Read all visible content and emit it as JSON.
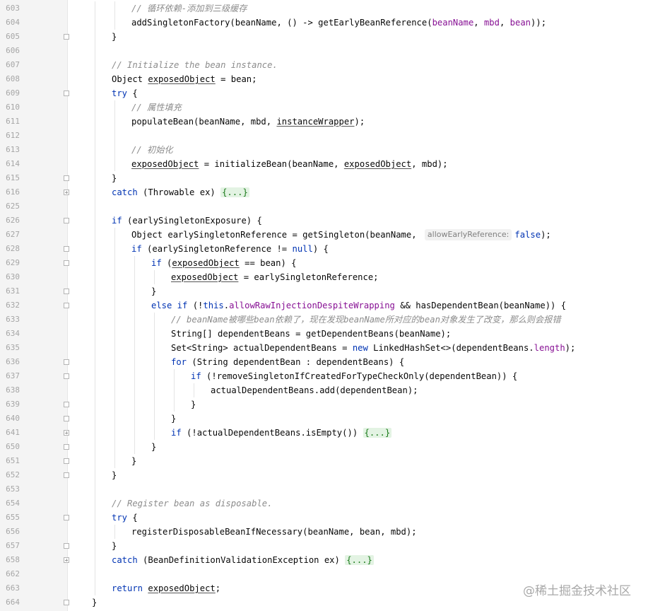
{
  "editor": {
    "lines": [
      {
        "n": "603",
        "indent": 3,
        "fold": "",
        "segs": [
          [
            "cm",
            "// 循环依赖-添加到三级缓存"
          ]
        ]
      },
      {
        "n": "604",
        "indent": 3,
        "fold": "",
        "segs": [
          [
            "",
            "addSingletonFactory(beanName, () -> getEarlyBeanReference("
          ],
          [
            "fd",
            "beanName"
          ],
          [
            "",
            ", "
          ],
          [
            "fd",
            "mbd"
          ],
          [
            "",
            ", "
          ],
          [
            "fd",
            "bean"
          ],
          [
            "",
            "));"
          ]
        ]
      },
      {
        "n": "605",
        "indent": 2,
        "fold": "end",
        "segs": [
          [
            "",
            "}"
          ]
        ]
      },
      {
        "n": "606",
        "indent": 0,
        "fold": "",
        "segs": []
      },
      {
        "n": "607",
        "indent": 2,
        "fold": "",
        "segs": [
          [
            "cm",
            "// Initialize the bean instance."
          ]
        ]
      },
      {
        "n": "608",
        "indent": 2,
        "fold": "",
        "segs": [
          [
            "",
            "Object "
          ],
          [
            "ul",
            "exposedObject"
          ],
          [
            "",
            " = bean;"
          ]
        ]
      },
      {
        "n": "609",
        "indent": 2,
        "fold": "start",
        "segs": [
          [
            "kw",
            "try"
          ],
          [
            "",
            " {"
          ]
        ]
      },
      {
        "n": "610",
        "indent": 3,
        "fold": "",
        "segs": [
          [
            "cm",
            "// 属性填充"
          ]
        ]
      },
      {
        "n": "611",
        "indent": 3,
        "fold": "",
        "segs": [
          [
            "",
            "populateBean(beanName, mbd, "
          ],
          [
            "ul",
            "instanceWrapper"
          ],
          [
            "",
            ");"
          ]
        ]
      },
      {
        "n": "612",
        "indent": 0,
        "fold": "",
        "segs": []
      },
      {
        "n": "613",
        "indent": 3,
        "fold": "",
        "segs": [
          [
            "cm",
            "// 初始化"
          ]
        ]
      },
      {
        "n": "614",
        "indent": 3,
        "fold": "",
        "segs": [
          [
            "ul",
            "exposedObject"
          ],
          [
            "",
            " = initializeBean(beanName, "
          ],
          [
            "ul",
            "exposedObject"
          ],
          [
            "",
            ", mbd);"
          ]
        ]
      },
      {
        "n": "615",
        "indent": 2,
        "fold": "end",
        "segs": [
          [
            "",
            "}"
          ]
        ]
      },
      {
        "n": "616",
        "indent": 2,
        "fold": "plus",
        "segs": [
          [
            "kw",
            "catch"
          ],
          [
            "",
            " (Throwable ex) "
          ],
          [
            "fl",
            "{...}"
          ]
        ]
      },
      {
        "n": "625",
        "indent": 0,
        "fold": "",
        "segs": []
      },
      {
        "n": "626",
        "indent": 2,
        "fold": "start",
        "segs": [
          [
            "kw",
            "if"
          ],
          [
            "",
            " (earlySingletonExposure) {"
          ]
        ]
      },
      {
        "n": "627",
        "indent": 3,
        "fold": "",
        "segs": [
          [
            "",
            "Object earlySingletonReference = getSingleton(beanName, "
          ],
          [
            "hint",
            "allowEarlyReference:"
          ],
          [
            "kw",
            "false"
          ],
          [
            "",
            ");"
          ]
        ]
      },
      {
        "n": "628",
        "indent": 3,
        "fold": "start",
        "segs": [
          [
            "kw",
            "if"
          ],
          [
            "",
            " (earlySingletonReference != "
          ],
          [
            "kw",
            "null"
          ],
          [
            "",
            ") {"
          ]
        ]
      },
      {
        "n": "629",
        "indent": 4,
        "fold": "start",
        "segs": [
          [
            "kw",
            "if"
          ],
          [
            "",
            " ("
          ],
          [
            "ul",
            "exposedObject"
          ],
          [
            "",
            " == bean) {"
          ]
        ]
      },
      {
        "n": "630",
        "indent": 5,
        "fold": "",
        "segs": [
          [
            "ul",
            "exposedObject"
          ],
          [
            "",
            " = earlySingletonReference;"
          ]
        ]
      },
      {
        "n": "631",
        "indent": 4,
        "fold": "end",
        "segs": [
          [
            "",
            "}"
          ]
        ]
      },
      {
        "n": "632",
        "indent": 4,
        "fold": "start",
        "segs": [
          [
            "kw",
            "else if"
          ],
          [
            "",
            " (!"
          ],
          [
            "kw",
            "this"
          ],
          [
            "",
            "."
          ],
          [
            "fd",
            "allowRawInjectionDespiteWrapping"
          ],
          [
            "",
            " && hasDependentBean(beanName)) {"
          ]
        ]
      },
      {
        "n": "633",
        "indent": 5,
        "fold": "",
        "segs": [
          [
            "cm",
            "// beanName被哪些bean依赖了，现在发现beanName所对应的bean对象发生了改变，那么则会报错"
          ]
        ]
      },
      {
        "n": "634",
        "indent": 5,
        "fold": "",
        "segs": [
          [
            "",
            "String[] dependentBeans = getDependentBeans(beanName);"
          ]
        ]
      },
      {
        "n": "635",
        "indent": 5,
        "fold": "",
        "segs": [
          [
            "",
            "Set<String> actualDependentBeans = "
          ],
          [
            "kw",
            "new"
          ],
          [
            "",
            " LinkedHashSet<>(dependentBeans."
          ],
          [
            "fd",
            "length"
          ],
          [
            "",
            ");"
          ]
        ]
      },
      {
        "n": "636",
        "indent": 5,
        "fold": "start",
        "segs": [
          [
            "kw",
            "for"
          ],
          [
            "",
            " (String dependentBean : dependentBeans) {"
          ]
        ]
      },
      {
        "n": "637",
        "indent": 6,
        "fold": "start",
        "segs": [
          [
            "kw",
            "if"
          ],
          [
            "",
            " (!removeSingletonIfCreatedForTypeCheckOnly(dependentBean)) {"
          ]
        ]
      },
      {
        "n": "638",
        "indent": 7,
        "fold": "",
        "segs": [
          [
            "",
            "actualDependentBeans.add(dependentBean);"
          ]
        ]
      },
      {
        "n": "639",
        "indent": 6,
        "fold": "end",
        "segs": [
          [
            "",
            "}"
          ]
        ]
      },
      {
        "n": "640",
        "indent": 5,
        "fold": "end",
        "segs": [
          [
            "",
            "}"
          ]
        ]
      },
      {
        "n": "641",
        "indent": 5,
        "fold": "plus",
        "segs": [
          [
            "kw",
            "if"
          ],
          [
            "",
            " (!actualDependentBeans.isEmpty()) "
          ],
          [
            "fl",
            "{...}"
          ]
        ]
      },
      {
        "n": "650",
        "indent": 4,
        "fold": "end",
        "segs": [
          [
            "",
            "}"
          ]
        ]
      },
      {
        "n": "651",
        "indent": 3,
        "fold": "end",
        "segs": [
          [
            "",
            "}"
          ]
        ]
      },
      {
        "n": "652",
        "indent": 2,
        "fold": "end",
        "segs": [
          [
            "",
            "}"
          ]
        ]
      },
      {
        "n": "653",
        "indent": 0,
        "fold": "",
        "segs": []
      },
      {
        "n": "654",
        "indent": 2,
        "fold": "",
        "segs": [
          [
            "cm",
            "// Register bean as disposable."
          ]
        ]
      },
      {
        "n": "655",
        "indent": 2,
        "fold": "start",
        "segs": [
          [
            "kw",
            "try"
          ],
          [
            "",
            " {"
          ]
        ]
      },
      {
        "n": "656",
        "indent": 3,
        "fold": "",
        "segs": [
          [
            "",
            "registerDisposableBeanIfNecessary(beanName, bean, mbd);"
          ]
        ]
      },
      {
        "n": "657",
        "indent": 2,
        "fold": "end",
        "segs": [
          [
            "",
            "}"
          ]
        ]
      },
      {
        "n": "658",
        "indent": 2,
        "fold": "plus",
        "segs": [
          [
            "kw",
            "catch"
          ],
          [
            "",
            " (BeanDefinitionValidationException ex) "
          ],
          [
            "fl",
            "{...}"
          ]
        ]
      },
      {
        "n": "662",
        "indent": 0,
        "fold": "",
        "segs": []
      },
      {
        "n": "663",
        "indent": 2,
        "fold": "",
        "segs": [
          [
            "kw",
            "return"
          ],
          [
            "",
            " "
          ],
          [
            "ul",
            "exposedObject"
          ],
          [
            "",
            ";"
          ]
        ]
      },
      {
        "n": "664",
        "indent": 1,
        "fold": "end",
        "segs": [
          [
            "",
            "}"
          ]
        ]
      }
    ]
  },
  "watermark": "@稀土掘金技术社区",
  "colors": {
    "keyword": "#0033b3",
    "comment": "#8c8c8c",
    "field": "#871094",
    "folded": "#1a7a1a",
    "gutter": "#f4f4f4"
  }
}
